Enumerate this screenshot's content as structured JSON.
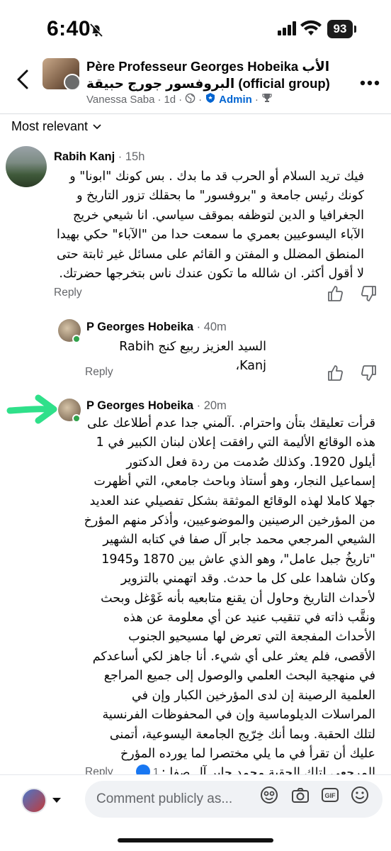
{
  "status_bar": {
    "time": "6:40",
    "battery": "93"
  },
  "group": {
    "title": "Père Professeur Georges Hobeika الأب البروفسور جورج حبيقة (official group)",
    "poster": "Vanessa Saba",
    "age": "1d",
    "admin_label": "Admin"
  },
  "sort": {
    "label": "Most relevant"
  },
  "comments": [
    {
      "author": "Rabih Kanj",
      "time": "15h",
      "text": "فيك تريد السلام أو الحرب قد ما بدك . بس كونك \"ابونا\" و كونك رئيس جامعة و \"بروفسور\" ما بحقلك تزور التاريخ و الجغرافيا و الدين لتوظفه بموقف سياسي. انا شيعي خريج الآباء اليسوعيين بعمري ما سمعت حدا من \"الآباء\" حكي بهيدا المنطق المضلل و المفتن و القائم على مسائل غير ثابتة حتى لا أقول أكثر. ان شالله ما تكون عندك ناس بتخرجها حضرتك.",
      "reply_label": "Reply"
    },
    {
      "author": "P Georges Hobeika",
      "time": "40m",
      "text": "السيد العزيز ربيع كنج Rabih Kanj،",
      "reply_label": "Reply"
    },
    {
      "author": "P Georges Hobeika",
      "time": "20m",
      "text": "قرأت تعليقك بتأن واحترام. .آلمني جدا عدم أطلاعك على هذه الوقائع الأليمة التي رافقت إعلان لبنان الكبير في 1 أيلول 1920. وكذلك صُدمت من ردة فعل الدكتور إسماعيل النجار، وهو أستاذ وباحث جامعي، التي أظهرت جهلا كاملا لهذه الوقائع الموثقة بشكل تفصيلي عند العديد من المؤرخين الرصينين والموضوعيين، وأذكر منهم المؤرخ الشيعي المرجعي محمد جابر آل صفا في كتابه الشهير \"تاريخُ جبل عامل\"، وهو الذي عاش بين 1870 و1945 وكان شاهدا على كل ما حدث. وقد اتهمني بالتزوير لأحداث التاريخ وحاول أن يقنع متابعيه بأنه غَوْغل وبحث ونقَّب ذاته في تنقيب عنيد عن أي معلومة عن هذه الأحداث المفجعة التي تعرض لها مسيحيو الجنوب الأقصى، فلم يعثر على أي شيء. أنا جاهز لكي أساعدكم في منهجية البحث العلمي والوصول إلى جميع المراجع العلمية الرصينة إن لدى المؤرخين الكبار وإن في المراسلات الديلوماسية وإن في المحفوظات الفرنسية لتلك الحقبة. وبما أنك خِرّيج الجامعة اليسوعية، أتمنى عليك أن تقرأ في ما يلي مختصرا لما يورده المؤرخ المرجعي لتلك الحقبة محمد جابر آل صفا :",
      "reply_label": "Reply",
      "reaction_count": "1"
    }
  ],
  "composer": {
    "placeholder": "Comment publicly as..."
  },
  "colors": {
    "accent": "#0064d1",
    "online": "#31a24c",
    "arrow": "#2fe08a"
  }
}
